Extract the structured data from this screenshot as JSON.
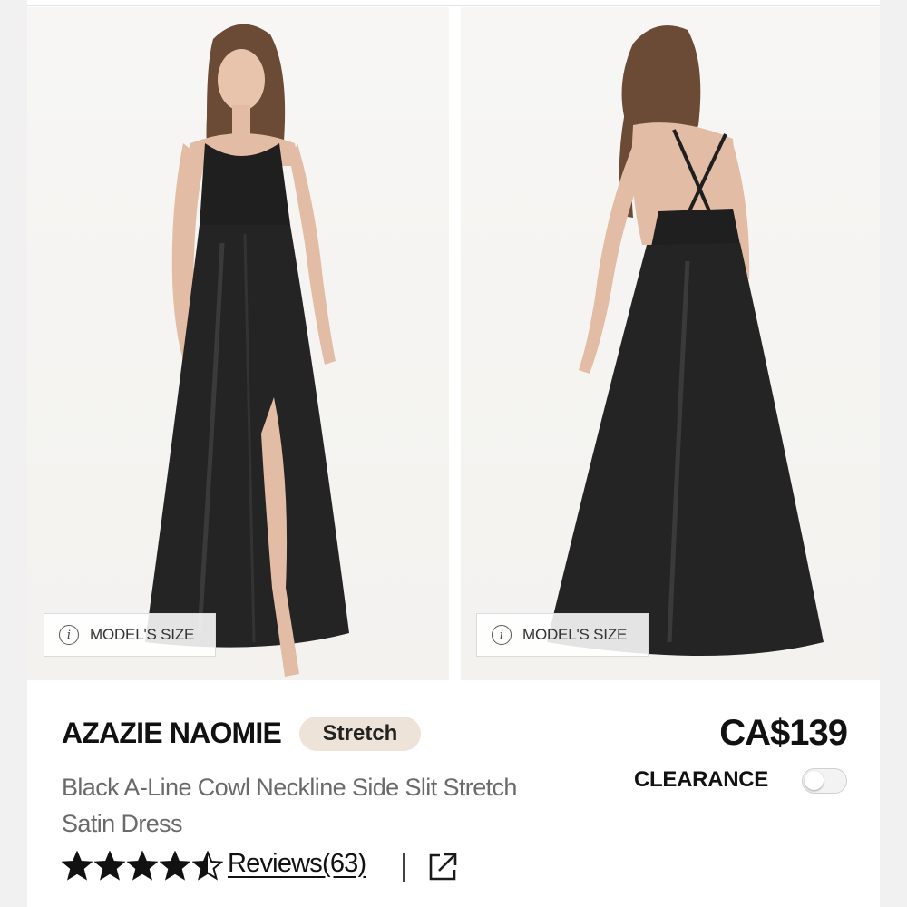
{
  "photos": {
    "front": {
      "model_size_label": "MODEL'S SIZE",
      "info_icon": "info-icon"
    },
    "back": {
      "model_size_label": "MODEL'S SIZE",
      "info_icon": "info-icon"
    }
  },
  "product": {
    "name": "AZAZIE NAOMIE",
    "badge": "Stretch",
    "description": "Black A-Line Cowl Neckline Side Slit Stretch Satin Dress",
    "price": "CA$139",
    "clearance_label": "CLEARANCE",
    "clearance_on": false,
    "rating": 4.5,
    "rating_max": 5,
    "reviews_label": "Reviews(63)",
    "share_icon": "share-external-icon"
  },
  "colors": {
    "badge_bg": "#ede3d9",
    "dress": "#1f1f1f",
    "text_primary": "#111111",
    "text_secondary": "#6a6a6a"
  }
}
